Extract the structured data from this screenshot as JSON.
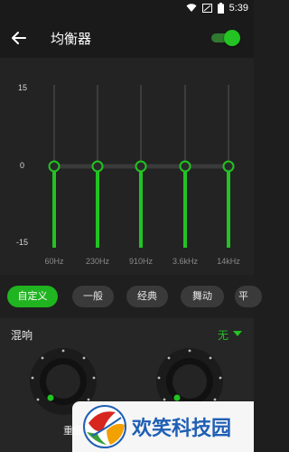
{
  "status": {
    "time": "5:39",
    "icons": [
      "wifi-icon",
      "signal-icon",
      "battery-icon"
    ]
  },
  "app": {
    "title": "均衡器",
    "enabled": true
  },
  "equalizer": {
    "db_max_label": "15",
    "db_mid_label": "0",
    "db_min_label": "-15",
    "bands": [
      {
        "freq": "60Hz",
        "gain_db": 0
      },
      {
        "freq": "230Hz",
        "gain_db": 0
      },
      {
        "freq": "910Hz",
        "gain_db": 0
      },
      {
        "freq": "3.6kHz",
        "gain_db": 0
      },
      {
        "freq": "14kHz",
        "gain_db": 0
      }
    ]
  },
  "presets": {
    "items": [
      "自定义",
      "一般",
      "经典",
      "舞动",
      "平"
    ],
    "selected": "自定义"
  },
  "reverb": {
    "title": "混响",
    "value": "无"
  },
  "knobs": {
    "left_label": "重低音"
  },
  "logo": {
    "text": "欢笑科技园"
  },
  "colors": {
    "accent": "#22c322",
    "background": "#1e1e1e"
  }
}
